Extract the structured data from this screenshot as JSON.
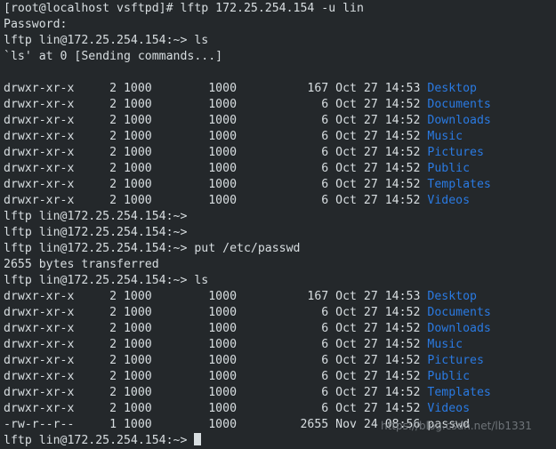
{
  "terminal": {
    "background_color": "#24282b",
    "text_color": "#d8dee1",
    "directory_color": "#2a7ae2",
    "watermark": "https://blog.csdn.net/lb1331",
    "cursor": "block",
    "prompt_shell": "[root@localhost vsftpd]#",
    "prompt_lftp": "lftp lin@172.25.254.154:~>"
  },
  "lines": [
    {
      "id": "l01",
      "type": "command",
      "text": "[root@localhost vsftpd]# lftp 172.25.254.154 -u lin"
    },
    {
      "id": "l02",
      "type": "output",
      "text": "Password:"
    },
    {
      "id": "l03",
      "type": "command",
      "text": "lftp lin@172.25.254.154:~> ls"
    },
    {
      "id": "l04",
      "type": "output",
      "text": "`ls' at 0 [Sending commands...]"
    },
    {
      "id": "l05",
      "type": "blank",
      "text": ""
    },
    {
      "id": "l06",
      "type": "listing",
      "perms": "drwxr-xr-x",
      "links": "2",
      "owner": "1000",
      "group": "1000",
      "size": "167",
      "month": "Oct",
      "day": "27",
      "time": "14:53",
      "name": "Desktop",
      "is_dir": true
    },
    {
      "id": "l07",
      "type": "listing",
      "perms": "drwxr-xr-x",
      "links": "2",
      "owner": "1000",
      "group": "1000",
      "size": "6",
      "month": "Oct",
      "day": "27",
      "time": "14:52",
      "name": "Documents",
      "is_dir": true
    },
    {
      "id": "l08",
      "type": "listing",
      "perms": "drwxr-xr-x",
      "links": "2",
      "owner": "1000",
      "group": "1000",
      "size": "6",
      "month": "Oct",
      "day": "27",
      "time": "14:52",
      "name": "Downloads",
      "is_dir": true
    },
    {
      "id": "l09",
      "type": "listing",
      "perms": "drwxr-xr-x",
      "links": "2",
      "owner": "1000",
      "group": "1000",
      "size": "6",
      "month": "Oct",
      "day": "27",
      "time": "14:52",
      "name": "Music",
      "is_dir": true
    },
    {
      "id": "l10",
      "type": "listing",
      "perms": "drwxr-xr-x",
      "links": "2",
      "owner": "1000",
      "group": "1000",
      "size": "6",
      "month": "Oct",
      "day": "27",
      "time": "14:52",
      "name": "Pictures",
      "is_dir": true
    },
    {
      "id": "l11",
      "type": "listing",
      "perms": "drwxr-xr-x",
      "links": "2",
      "owner": "1000",
      "group": "1000",
      "size": "6",
      "month": "Oct",
      "day": "27",
      "time": "14:52",
      "name": "Public",
      "is_dir": true
    },
    {
      "id": "l12",
      "type": "listing",
      "perms": "drwxr-xr-x",
      "links": "2",
      "owner": "1000",
      "group": "1000",
      "size": "6",
      "month": "Oct",
      "day": "27",
      "time": "14:52",
      "name": "Templates",
      "is_dir": true
    },
    {
      "id": "l13",
      "type": "listing",
      "perms": "drwxr-xr-x",
      "links": "2",
      "owner": "1000",
      "group": "1000",
      "size": "6",
      "month": "Oct",
      "day": "27",
      "time": "14:52",
      "name": "Videos",
      "is_dir": true
    },
    {
      "id": "l14",
      "type": "command",
      "text": "lftp lin@172.25.254.154:~>"
    },
    {
      "id": "l15",
      "type": "command",
      "text": "lftp lin@172.25.254.154:~>"
    },
    {
      "id": "l16",
      "type": "command",
      "text": "lftp lin@172.25.254.154:~> put /etc/passwd"
    },
    {
      "id": "l17",
      "type": "output",
      "text": "2655 bytes transferred"
    },
    {
      "id": "l18",
      "type": "command",
      "text": "lftp lin@172.25.254.154:~> ls"
    },
    {
      "id": "l19",
      "type": "listing",
      "perms": "drwxr-xr-x",
      "links": "2",
      "owner": "1000",
      "group": "1000",
      "size": "167",
      "month": "Oct",
      "day": "27",
      "time": "14:53",
      "name": "Desktop",
      "is_dir": true
    },
    {
      "id": "l20",
      "type": "listing",
      "perms": "drwxr-xr-x",
      "links": "2",
      "owner": "1000",
      "group": "1000",
      "size": "6",
      "month": "Oct",
      "day": "27",
      "time": "14:52",
      "name": "Documents",
      "is_dir": true
    },
    {
      "id": "l21",
      "type": "listing",
      "perms": "drwxr-xr-x",
      "links": "2",
      "owner": "1000",
      "group": "1000",
      "size": "6",
      "month": "Oct",
      "day": "27",
      "time": "14:52",
      "name": "Downloads",
      "is_dir": true
    },
    {
      "id": "l22",
      "type": "listing",
      "perms": "drwxr-xr-x",
      "links": "2",
      "owner": "1000",
      "group": "1000",
      "size": "6",
      "month": "Oct",
      "day": "27",
      "time": "14:52",
      "name": "Music",
      "is_dir": true
    },
    {
      "id": "l23",
      "type": "listing",
      "perms": "drwxr-xr-x",
      "links": "2",
      "owner": "1000",
      "group": "1000",
      "size": "6",
      "month": "Oct",
      "day": "27",
      "time": "14:52",
      "name": "Pictures",
      "is_dir": true
    },
    {
      "id": "l24",
      "type": "listing",
      "perms": "drwxr-xr-x",
      "links": "2",
      "owner": "1000",
      "group": "1000",
      "size": "6",
      "month": "Oct",
      "day": "27",
      "time": "14:52",
      "name": "Public",
      "is_dir": true
    },
    {
      "id": "l25",
      "type": "listing",
      "perms": "drwxr-xr-x",
      "links": "2",
      "owner": "1000",
      "group": "1000",
      "size": "6",
      "month": "Oct",
      "day": "27",
      "time": "14:52",
      "name": "Templates",
      "is_dir": true
    },
    {
      "id": "l26",
      "type": "listing",
      "perms": "drwxr-xr-x",
      "links": "2",
      "owner": "1000",
      "group": "1000",
      "size": "6",
      "month": "Oct",
      "day": "27",
      "time": "14:52",
      "name": "Videos",
      "is_dir": true
    },
    {
      "id": "l27",
      "type": "listing",
      "perms": "-rw-r--r--",
      "links": "1",
      "owner": "1000",
      "group": "1000",
      "size": "2655",
      "month": "Nov",
      "day": "24",
      "time": "08:56",
      "name": "passwd",
      "is_dir": false
    },
    {
      "id": "l28",
      "type": "prompt_cursor",
      "text": "lftp lin@172.25.254.154:~> "
    }
  ]
}
